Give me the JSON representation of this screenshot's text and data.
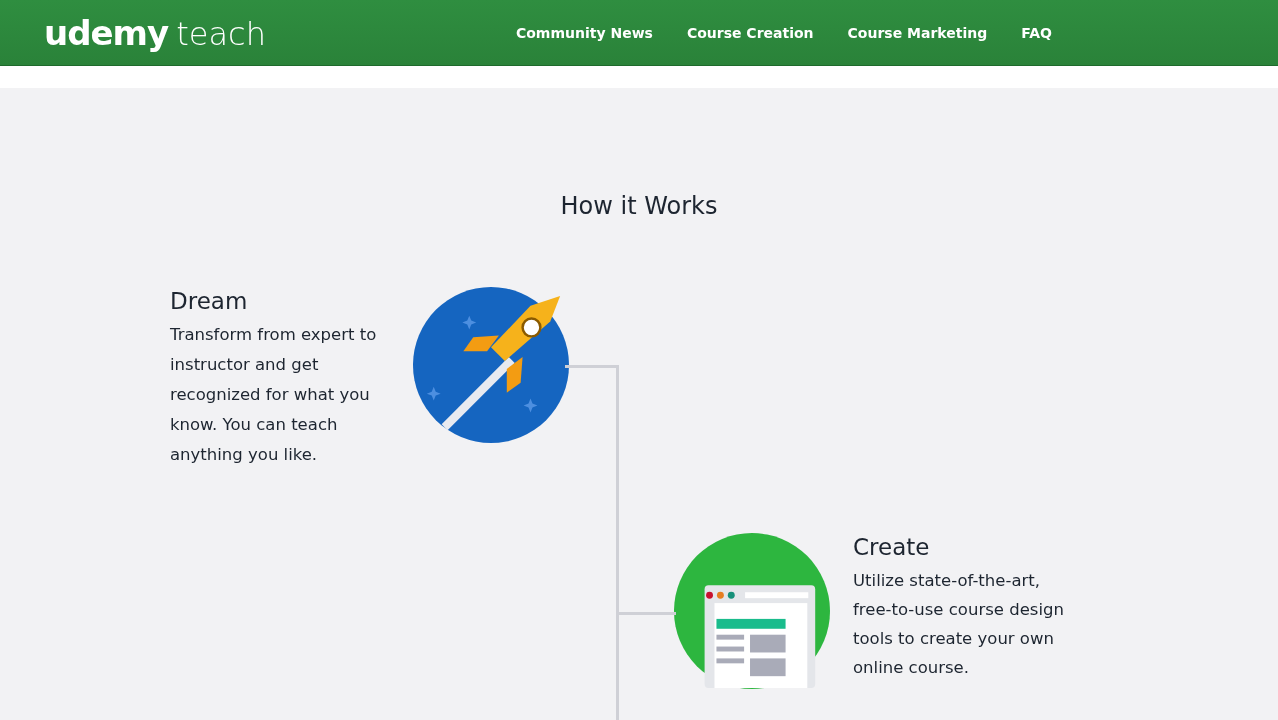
{
  "header": {
    "logo": {
      "brand": "udemy",
      "product": "teach"
    },
    "nav": [
      "Community News",
      "Course Creation",
      "Course Marketing",
      "FAQ"
    ]
  },
  "section_title": "How it Works",
  "steps": [
    {
      "kind": "rocket",
      "title": "Dream",
      "text": "Transform from expert to\ninstructor and get\nrecognized for what you\nknow. You can teach\nanything you like."
    },
    {
      "kind": "browser",
      "title": "Create",
      "text": "Utilize state-of-the-art,\nfree-to-use course design\ntools to create your own\nonline course."
    }
  ]
}
